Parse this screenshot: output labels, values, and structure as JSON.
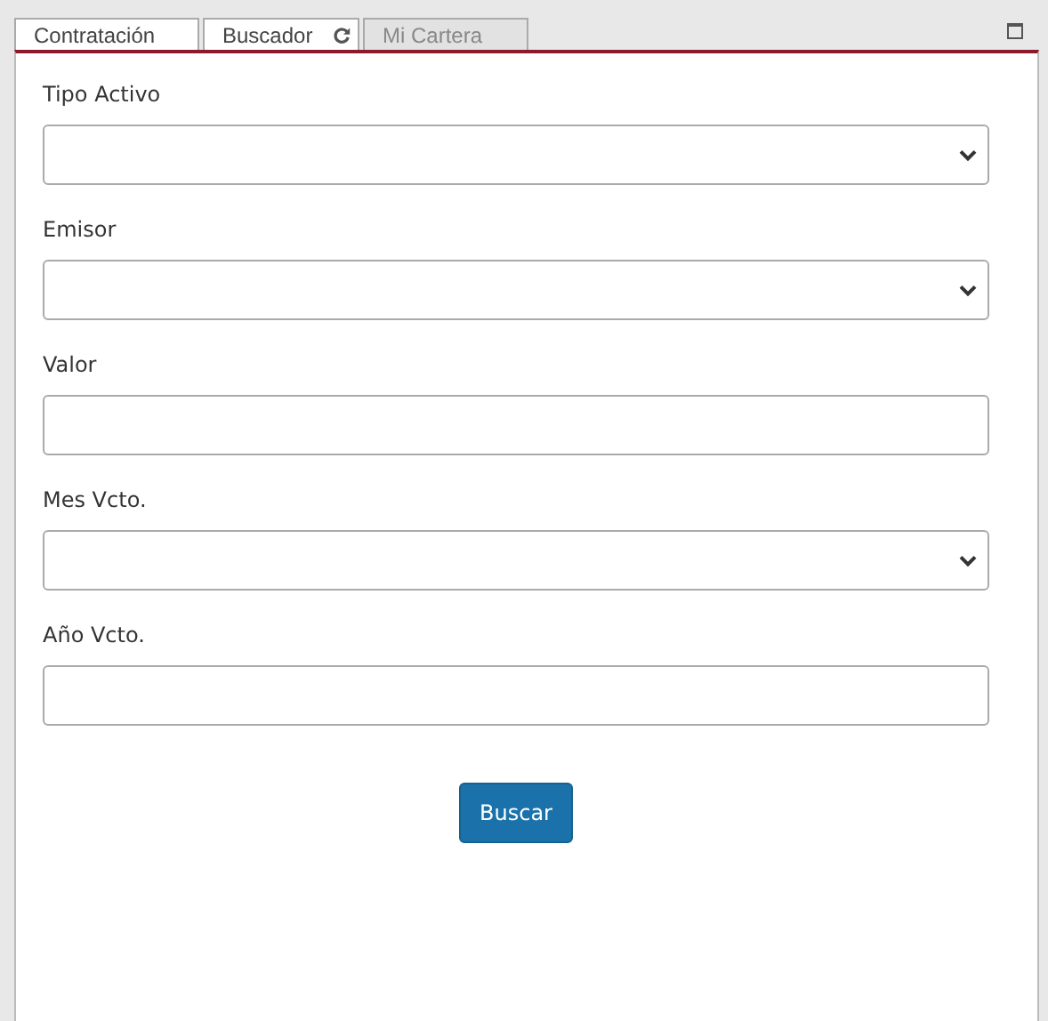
{
  "tabs": [
    {
      "label": "Contratación",
      "disabled": false,
      "refresh": false
    },
    {
      "label": "Buscador",
      "disabled": false,
      "refresh": true
    },
    {
      "label": "Mi Cartera",
      "disabled": true,
      "refresh": false
    }
  ],
  "fields": [
    {
      "label": "Tipo Activo",
      "kind": "select"
    },
    {
      "label": "Emisor",
      "kind": "select"
    },
    {
      "label": "Valor",
      "kind": "text"
    },
    {
      "label": "Mes Vcto.",
      "kind": "select"
    },
    {
      "label": "Año Vcto.",
      "kind": "text"
    }
  ],
  "button": "Buscar"
}
